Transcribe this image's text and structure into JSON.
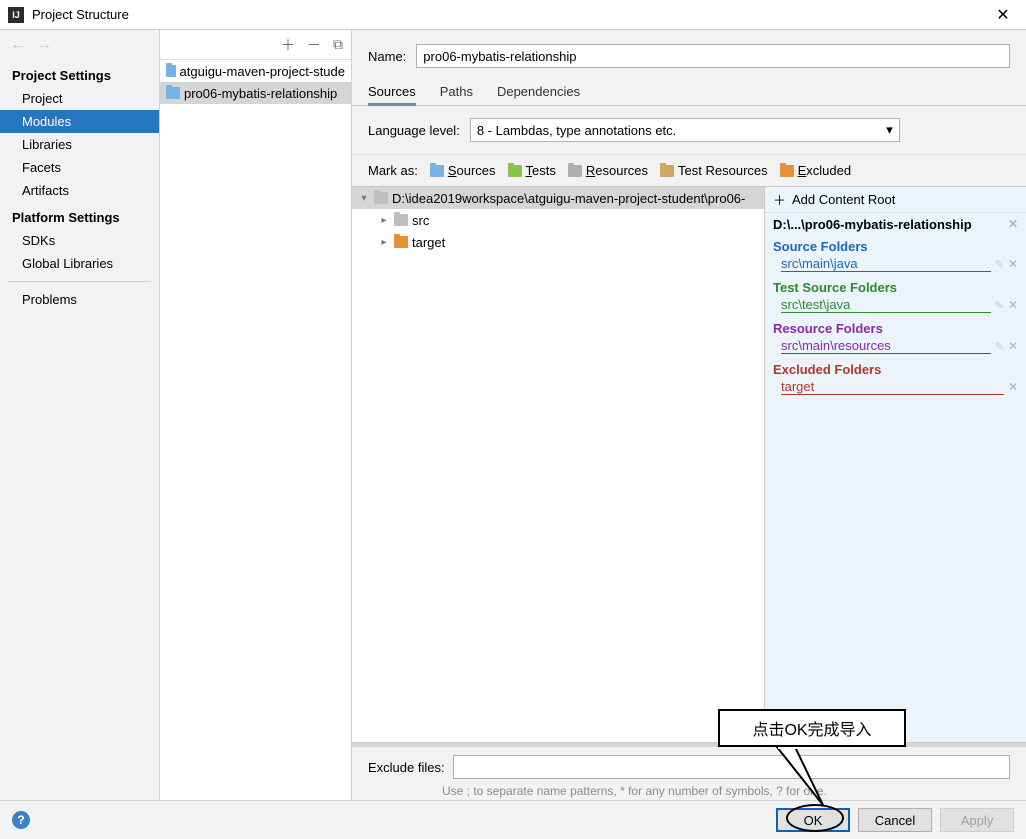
{
  "titlebar": {
    "title": "Project Structure"
  },
  "leftnav": {
    "section1": "Project Settings",
    "items1": [
      "Project",
      "Modules",
      "Libraries",
      "Facets",
      "Artifacts"
    ],
    "section2": "Platform Settings",
    "items2": [
      "SDKs",
      "Global Libraries"
    ],
    "problems": "Problems"
  },
  "modlist": {
    "items": [
      {
        "label": "atguigu-maven-project-stude",
        "selected": false
      },
      {
        "label": "pro06-mybatis-relationship",
        "selected": true
      }
    ]
  },
  "detail": {
    "name_label": "Name:",
    "name_value": "pro06-mybatis-relationship",
    "tabs": {
      "sources": "Sources",
      "paths": "Paths",
      "deps": "Dependencies"
    },
    "lang_label": "Language level:",
    "lang_value": "8 - Lambdas, type annotations etc.",
    "mark_label": "Mark as:",
    "marks": {
      "sources": "Sources",
      "tests": "Tests",
      "resources": "Resources",
      "tresources": "Test Resources",
      "excluded": "Excluded"
    },
    "tree": {
      "root": "D:\\idea2019workspace\\atguigu-maven-project-student\\pro06-",
      "children": [
        "src",
        "target"
      ]
    },
    "roots": {
      "add_label": "Add Content Root",
      "path": "D:\\...\\pro06-mybatis-relationship",
      "source_folders": "Source Folders",
      "source_item": "src\\main\\java",
      "test_folders": "Test Source Folders",
      "test_item": "src\\test\\java",
      "resource_folders": "Resource Folders",
      "resource_item": "src\\main\\resources",
      "excluded_folders": "Excluded Folders",
      "excluded_item": "target"
    },
    "exclude_label": "Exclude files:",
    "exclude_hint": "Use ; to separate name patterns, * for any number of symbols, ? for one."
  },
  "buttons": {
    "ok": "OK",
    "cancel": "Cancel",
    "apply": "Apply"
  },
  "callout": "点击OK完成导入",
  "mnemonic": {
    "S": "S",
    "T": "T",
    "R": "R",
    "E": "E",
    "C": "C"
  }
}
